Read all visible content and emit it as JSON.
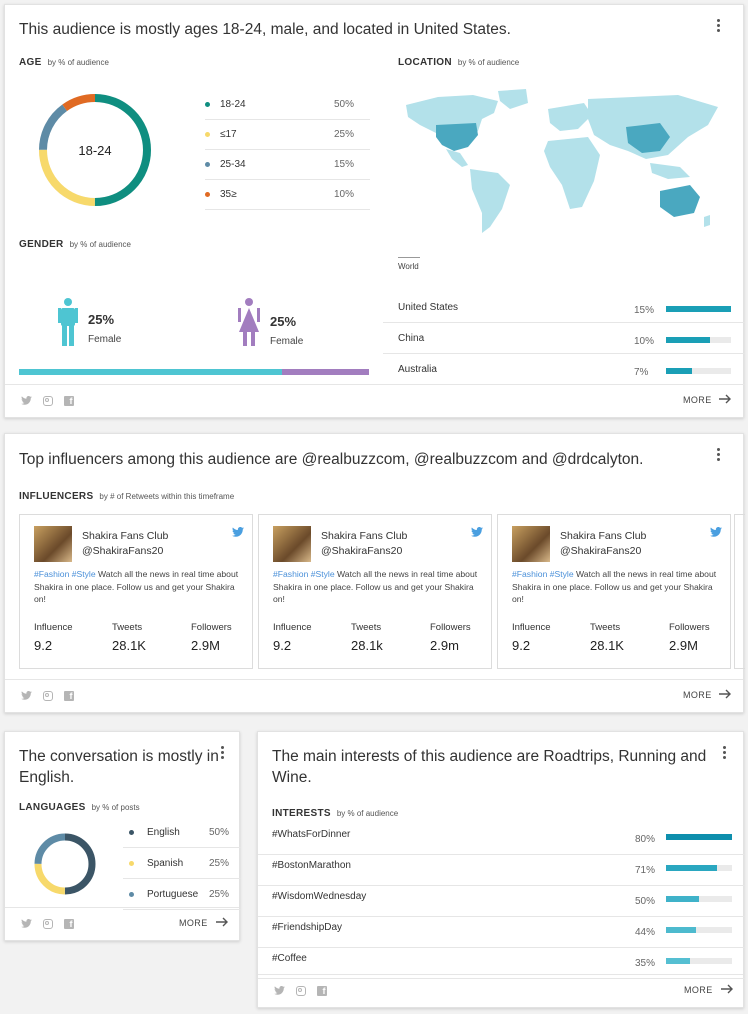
{
  "colors": {
    "teal": "#0f8e80",
    "yellow": "#f7d96b",
    "slate": "#5e8ba6",
    "orange": "#e06a23",
    "bar": "#1a9fb6",
    "female": "#a27dbf",
    "male": "#4ec5d2",
    "map_light": "#b3e1ea",
    "map_dark": "#4aa8c0",
    "twitter": "#4a9fe0"
  },
  "audience": {
    "headline": "This audience is mostly ages 18-24, male, and located in United States.",
    "age": {
      "title": "AGE",
      "subtitle": "by % of audience",
      "center_label": "18-24",
      "items": [
        {
          "label": "18-24",
          "value": "50%",
          "pct": 50,
          "color": "#0f8e80"
        },
        {
          "label": "≤17",
          "value": "25%",
          "pct": 25,
          "color": "#f7d96b"
        },
        {
          "label": "25-34",
          "value": "15%",
          "pct": 15,
          "color": "#5e8ba6"
        },
        {
          "label": "35≥",
          "value": "10%",
          "pct": 10,
          "color": "#e06a23"
        }
      ]
    },
    "gender": {
      "title": "GENDER",
      "subtitle": "by % of audience",
      "male": {
        "value": "25%",
        "label": "Female"
      },
      "female": {
        "value": "25%",
        "label": "Female"
      },
      "male_share": 0.75
    },
    "location": {
      "title": "LOCATION",
      "subtitle": "by % of audience",
      "map_label": "World",
      "items": [
        {
          "label": "United States",
          "value": "15%",
          "pct": 100
        },
        {
          "label": "China",
          "value": "10%",
          "pct": 67
        },
        {
          "label": "Australia",
          "value": "7%",
          "pct": 40
        }
      ]
    },
    "more": "MORE"
  },
  "influencers": {
    "headline": "Top influencers among this audience are @realbuzzcom, @realbuzzcom and @drdcalyton.",
    "title": "INFLUENCERS",
    "subtitle": "by # of Retweets within this timeframe",
    "cards": [
      {
        "name": "Shakira Fans Club",
        "handle": "@ShakiraFans20",
        "tags": "#Fashion #Style",
        "bio": " Watch all the news in real time about Shakira in one place. Follow us and get your Shakira on!",
        "influence_label": "Influence",
        "influence": "9.2",
        "tweets_label": "Tweets",
        "tweets": "28.1K",
        "followers_label": "Followers",
        "followers": "2.9M"
      },
      {
        "name": "Shakira Fans Club",
        "handle": "@ShakiraFans20",
        "tags": "#Fashion #Style",
        "bio": " Watch all the news in real time about Shakira in one place. Follow us and get your Shakira on!",
        "influence_label": "Influence",
        "influence": "9.2",
        "tweets_label": "Tweets",
        "tweets": "28.1k",
        "followers_label": "Followers",
        "followers": "2.9m"
      },
      {
        "name": "Shakira Fans Club",
        "handle": "@ShakiraFans20",
        "tags": "#Fashion #Style",
        "bio": " Watch all the news in real time about Shakira in one place. Follow us and get your Shakira on!",
        "influence_label": "Influence",
        "influence": "9.2",
        "tweets_label": "Tweets",
        "tweets": "28.1K",
        "followers_label": "Followers",
        "followers": "2.9M"
      }
    ],
    "more": "MORE"
  },
  "languages": {
    "headline": "The conversation is mostly in English.",
    "title": "LANGUAGES",
    "subtitle": "by % of posts",
    "items": [
      {
        "label": "English",
        "value": "50%",
        "pct": 50,
        "color": "#3b5566"
      },
      {
        "label": "Spanish",
        "value": "25%",
        "pct": 25,
        "color": "#f7d96b"
      },
      {
        "label": "Portuguese",
        "value": "25%",
        "pct": 25,
        "color": "#5e8ba6"
      }
    ],
    "more": "MORE"
  },
  "interests": {
    "headline": "The main interests of this audience are Roadtrips, Running and Wine.",
    "title": "INTERESTS",
    "subtitle": "by % of audience",
    "items": [
      {
        "label": "#WhatsForDinner",
        "value": "80%",
        "pct": 100,
        "color": "#0e8fad"
      },
      {
        "label": "#BostonMarathon",
        "value": "71%",
        "pct": 78,
        "color": "#2aa7c0"
      },
      {
        "label": "#WisdomWednesday",
        "value": "50%",
        "pct": 50,
        "color": "#3fb2c9"
      },
      {
        "label": "#FriendshipDay",
        "value": "44%",
        "pct": 46,
        "color": "#4dbace"
      },
      {
        "label": "#Coffee",
        "value": "35%",
        "pct": 36,
        "color": "#55bfd2"
      }
    ],
    "more": "MORE"
  }
}
